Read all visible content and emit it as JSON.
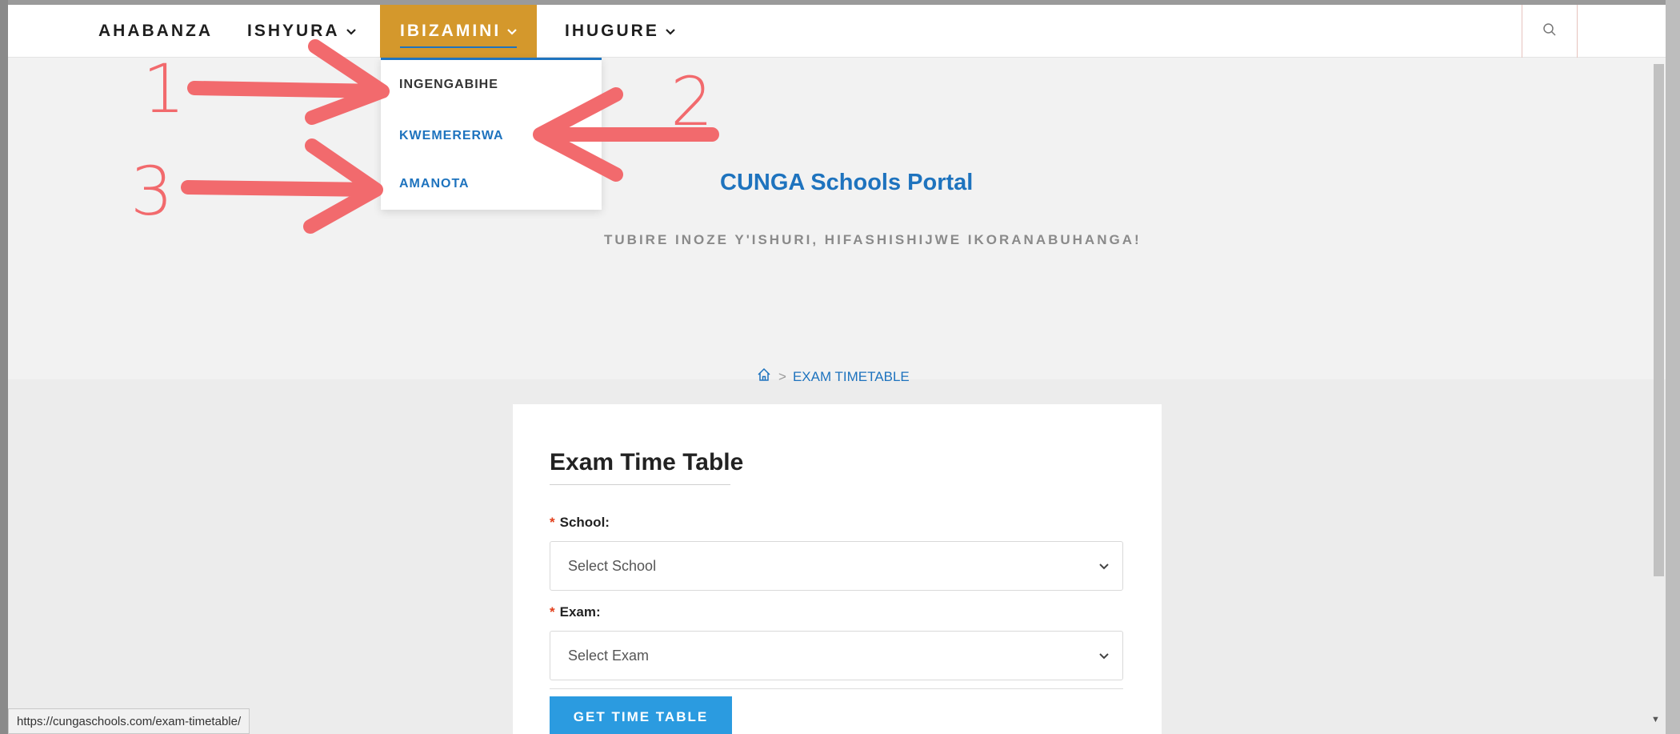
{
  "nav": {
    "items": [
      {
        "label": "AHABANZA",
        "has_dropdown": false
      },
      {
        "label": "ISHYURA",
        "has_dropdown": true
      },
      {
        "label": "IBIZAMINI",
        "has_dropdown": true,
        "active": true
      },
      {
        "label": "IHUGURE",
        "has_dropdown": true
      }
    ],
    "active_color": "#d4982c",
    "search_icon": "search-icon"
  },
  "dropdown": {
    "items": [
      {
        "label": "INGENGABIHE",
        "color": "#333333"
      },
      {
        "label": "KWEMERERWA",
        "color": "#1e73be"
      },
      {
        "label": "AMANOTA",
        "color": "#1e73be"
      }
    ]
  },
  "hero": {
    "title": "CUNGA Schools Portal",
    "subtitle": "TUBIRE INOZE Y'ISHURI, HIFASHISHIJWE IKORANABUHANGA!",
    "breadcrumb": {
      "home_icon": "home-icon",
      "separator": ">",
      "current": "EXAM TIMETABLE"
    }
  },
  "form": {
    "title": "Exam Time Table",
    "school_label": "School:",
    "school_placeholder": "Select School",
    "exam_label": "Exam:",
    "exam_placeholder": "Select Exam",
    "required_mark": "*",
    "submit_label": "GET TIME TABLE"
  },
  "status_bar": {
    "url": "https://cungaschools.com/exam-timetable/"
  },
  "annotations": {
    "numbers": [
      "1",
      "2",
      "3"
    ],
    "color": "#f26a6d"
  }
}
